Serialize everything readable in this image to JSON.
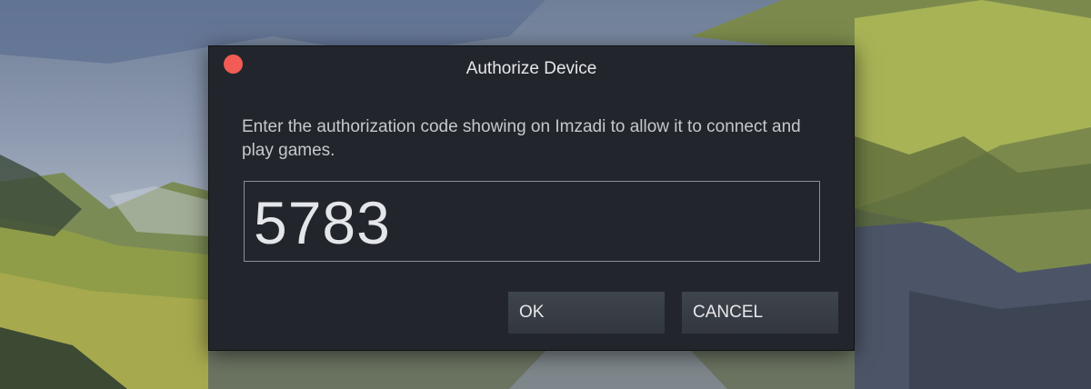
{
  "dialog": {
    "title": "Authorize Device",
    "message": "Enter the authorization code showing on Imzadi to allow it to connect and play games.",
    "code": "5783",
    "ok_label": "OK",
    "cancel_label": "CANCEL"
  },
  "colors": {
    "dialog_bg": "#22262c",
    "close_button": "#f25c55",
    "button_bg": "#3a3f46",
    "text": "#e6e7ea"
  }
}
